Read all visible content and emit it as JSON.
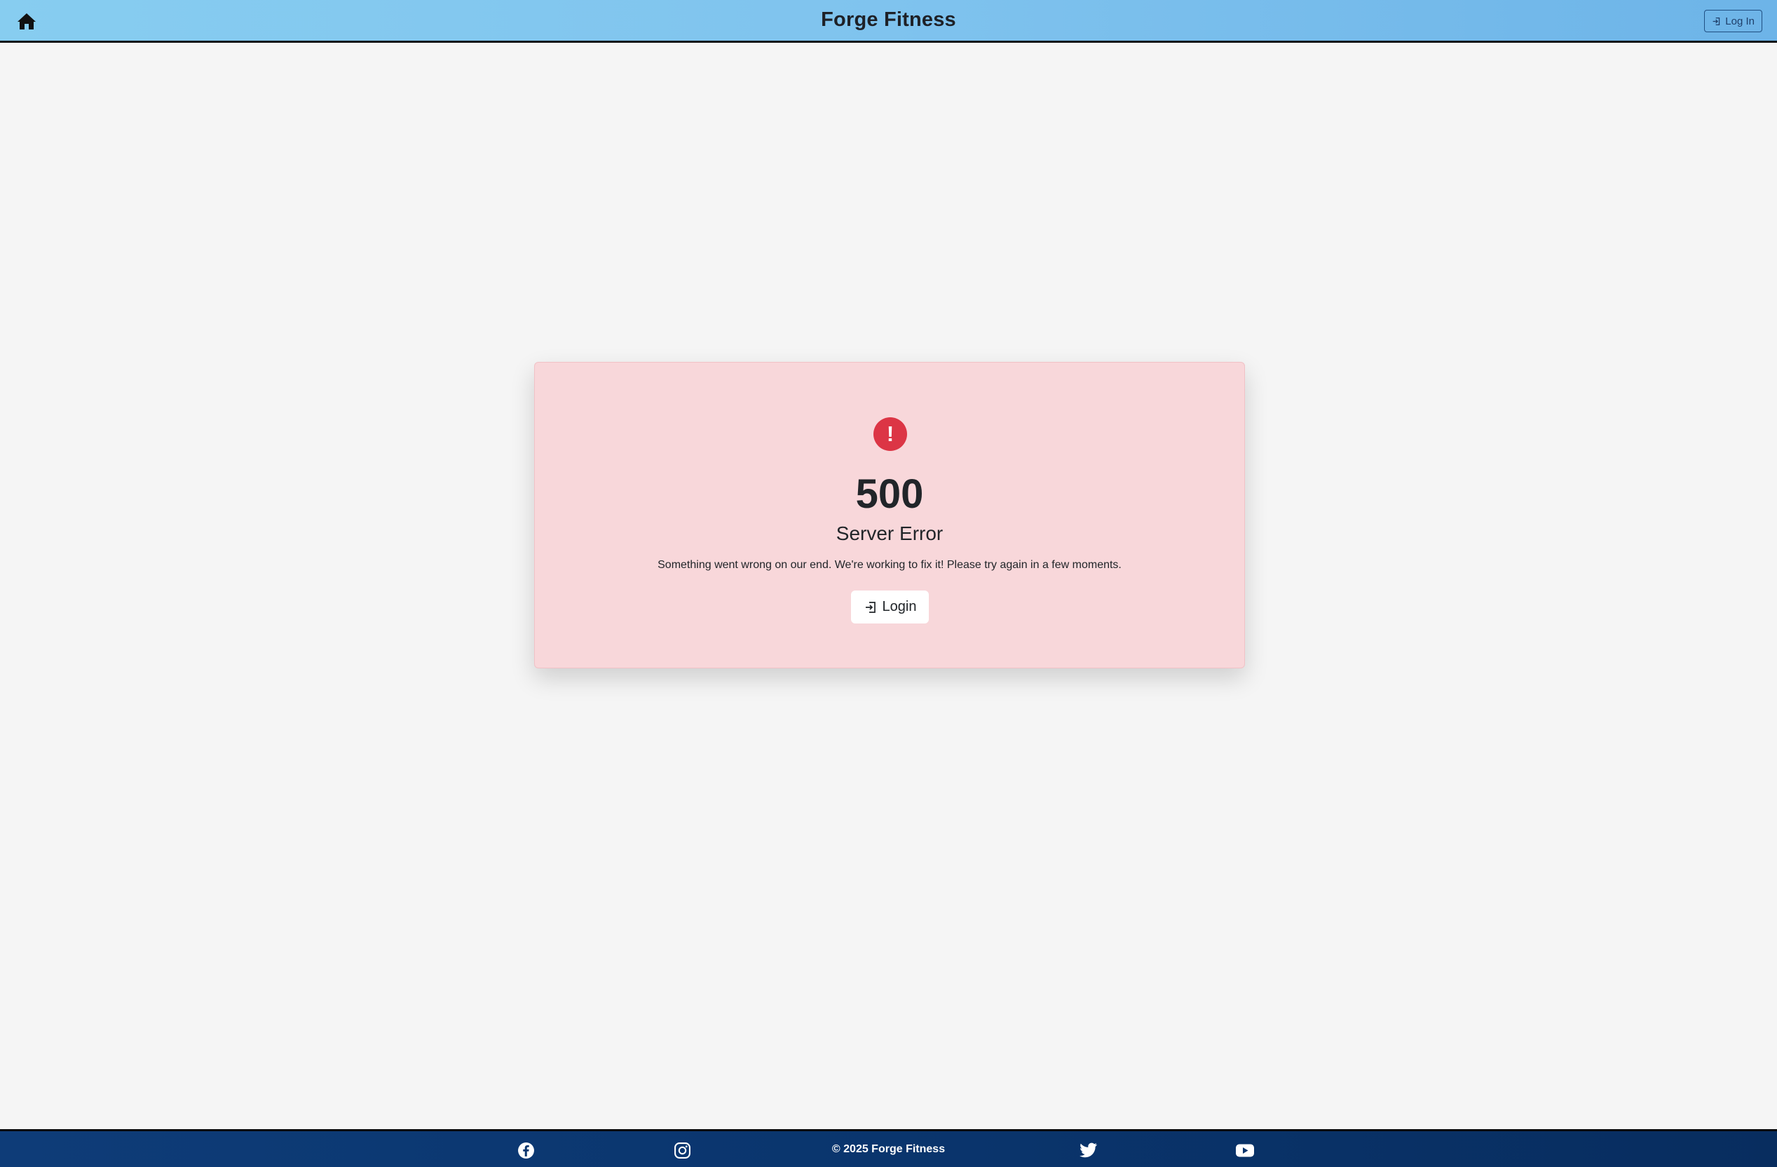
{
  "app": {
    "title": "Forge Fitness"
  },
  "header": {
    "home_icon": "home-icon",
    "login_button": {
      "label": "Log In",
      "icon": "login-icon"
    }
  },
  "error": {
    "icon": "exclamation-circle-icon",
    "code": "500",
    "title": "Server Error",
    "message": "Something went wrong on our end. We're working to fix it! Please try again in a few moments.",
    "button": {
      "label": "Login",
      "icon": "login-icon"
    }
  },
  "footer": {
    "copyright": "© 2025 Forge Fitness",
    "social": [
      {
        "name": "facebook",
        "icon": "facebook-icon"
      },
      {
        "name": "instagram",
        "icon": "instagram-icon"
      },
      {
        "name": "twitter",
        "icon": "twitter-icon"
      },
      {
        "name": "youtube",
        "icon": "youtube-icon"
      }
    ]
  },
  "colors": {
    "header_start": "#87cdf0",
    "header_end": "#6db4e8",
    "error_bg": "#f8d7da",
    "error_accent": "#dc3545",
    "footer_bg": "#0a356d",
    "page_bg": "#f5f5f5"
  }
}
